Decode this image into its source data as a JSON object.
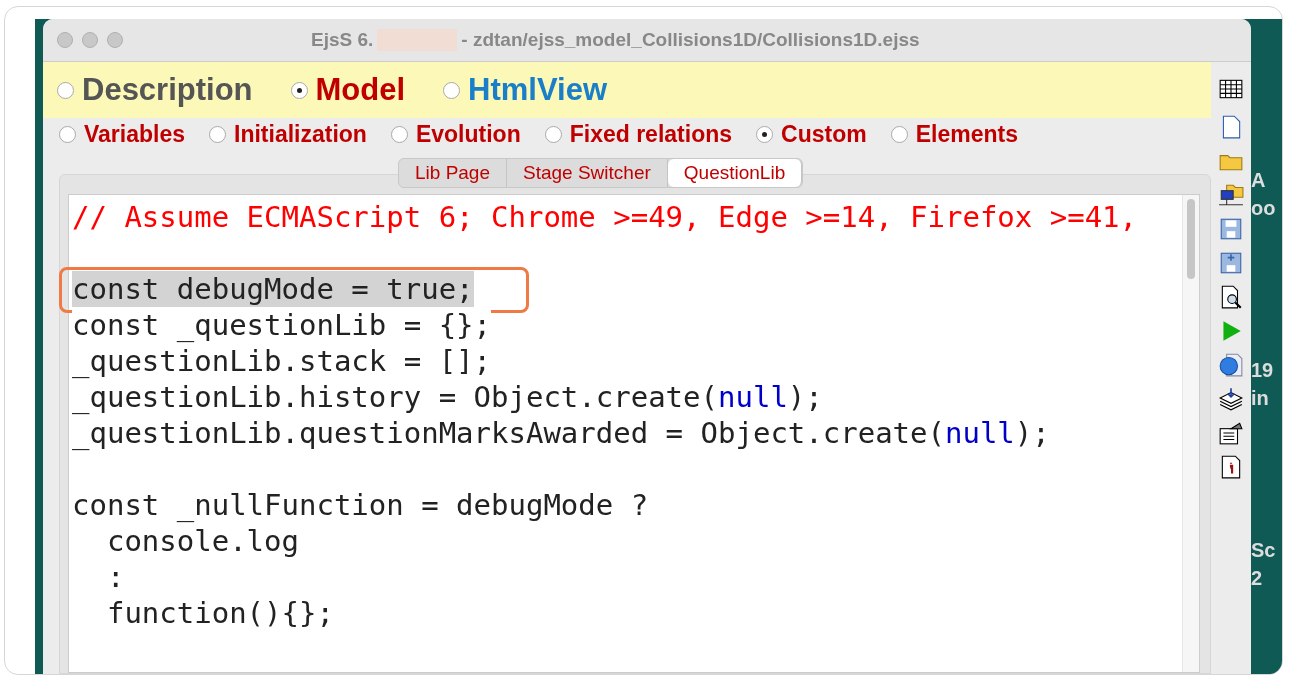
{
  "window": {
    "title_prefix": "EjsS 6.",
    "title_suffix": "- zdtan/ejss_model_Collisions1D/Collisions1D.ejss"
  },
  "main_tabs": [
    {
      "label": "Description",
      "selected": false,
      "color": "#555555"
    },
    {
      "label": "Model",
      "selected": true,
      "color": "#c00000"
    },
    {
      "label": "HtmlView",
      "selected": false,
      "color": "#1a7fc8"
    }
  ],
  "model_tabs": [
    {
      "label": "Variables",
      "selected": false
    },
    {
      "label": "Initialization",
      "selected": false
    },
    {
      "label": "Evolution",
      "selected": false
    },
    {
      "label": "Fixed relations",
      "selected": false
    },
    {
      "label": "Custom",
      "selected": true
    },
    {
      "label": "Elements",
      "selected": false
    }
  ],
  "page_tabs": [
    {
      "label": "Lib Page",
      "selected": false
    },
    {
      "label": "Stage Switcher",
      "selected": false
    },
    {
      "label": "QuestionLib",
      "selected": true
    }
  ],
  "code_blocks": [
    {
      "lines": [
        {
          "highlighted": false,
          "annotated": false,
          "segments": [
            {
              "kind": "comment",
              "text": "// Assume ECMAScript 6; Chrome >=49, Edge >=14, Firefox >=41,"
            }
          ]
        }
      ]
    },
    {
      "lines": [
        {
          "highlighted": true,
          "annotated": true,
          "segments": [
            {
              "kind": "plain",
              "text": "const debugMode = true;"
            }
          ]
        },
        {
          "highlighted": false,
          "annotated": false,
          "segments": [
            {
              "kind": "plain",
              "text": "const _questionLib = {};"
            }
          ]
        },
        {
          "highlighted": false,
          "annotated": false,
          "segments": [
            {
              "kind": "plain",
              "text": "_questionLib.stack = [];"
            }
          ]
        },
        {
          "highlighted": false,
          "annotated": false,
          "segments": [
            {
              "kind": "plain",
              "text": "_questionLib.history = Object.create("
            },
            {
              "kind": "keyword",
              "text": "null"
            },
            {
              "kind": "plain",
              "text": ");"
            }
          ]
        },
        {
          "highlighted": false,
          "annotated": false,
          "segments": [
            {
              "kind": "plain",
              "text": "_questionLib.questionMarksAwarded = Object.create("
            },
            {
              "kind": "keyword",
              "text": "null"
            },
            {
              "kind": "plain",
              "text": ");"
            }
          ]
        }
      ]
    },
    {
      "lines": [
        {
          "highlighted": false,
          "annotated": false,
          "segments": [
            {
              "kind": "plain",
              "text": "const _nullFunction = debugMode ?"
            }
          ]
        },
        {
          "highlighted": false,
          "annotated": false,
          "segments": [
            {
              "kind": "plain",
              "text": "  console.log"
            }
          ]
        },
        {
          "highlighted": false,
          "annotated": false,
          "segments": [
            {
              "kind": "plain",
              "text": "  :"
            }
          ]
        },
        {
          "highlighted": false,
          "annotated": false,
          "segments": [
            {
              "kind": "plain",
              "text": "  function(){};"
            }
          ]
        }
      ]
    }
  ],
  "toolbar": [
    {
      "kind": "table"
    },
    {
      "kind": "new"
    },
    {
      "kind": "folder"
    },
    {
      "kind": "network"
    },
    {
      "kind": "save"
    },
    {
      "kind": "saveas"
    },
    {
      "kind": "preview"
    },
    {
      "kind": "run"
    },
    {
      "kind": "web"
    },
    {
      "kind": "stack"
    },
    {
      "kind": "options"
    },
    {
      "kind": "info"
    }
  ],
  "desktop_fragments": [
    {
      "text": "A"
    },
    {
      "text": "oo"
    },
    {
      "text": "19"
    },
    {
      "text": "in"
    },
    {
      "text": "Sc"
    },
    {
      "text": "2"
    }
  ]
}
